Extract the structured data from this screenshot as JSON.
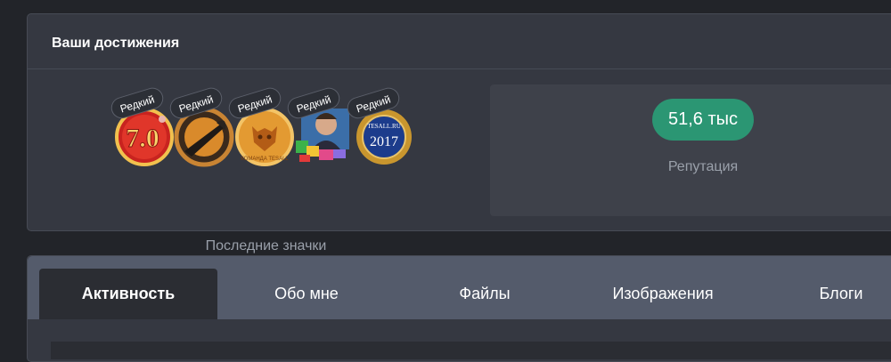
{
  "achievements": {
    "title": "Ваши достижения",
    "badges": [
      {
        "name": "badge-7-0",
        "rarity": "Редкий",
        "text": "7.0"
      },
      {
        "name": "badge-quill",
        "rarity": "Редкий",
        "text": ""
      },
      {
        "name": "badge-team",
        "rarity": "Редкий",
        "text": "КОМАНДА TESALL"
      },
      {
        "name": "badge-gifts",
        "rarity": "Редкий",
        "text": ""
      },
      {
        "name": "badge-2017",
        "rarity": "Редкий",
        "text": "TESALL.RU 2017"
      }
    ],
    "badges_caption": "Последние значки",
    "reputation_value": "51,6 тыс",
    "reputation_label": "Репутация"
  },
  "tabs": [
    {
      "label": "Активность",
      "active": true
    },
    {
      "label": "Обо мне",
      "active": false
    },
    {
      "label": "Файлы",
      "active": false
    },
    {
      "label": "Изображения",
      "active": false
    },
    {
      "label": "Блоги",
      "active": false
    }
  ],
  "colors": {
    "page_bg": "#222429",
    "panel_bg": "#353841",
    "tab_strip": "#545b6b",
    "reputation_pill": "#2b9673"
  }
}
